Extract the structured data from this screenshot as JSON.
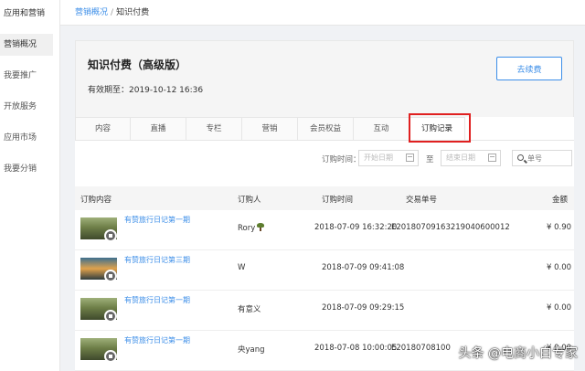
{
  "sidebar": {
    "title": "应用和营销",
    "items": [
      {
        "label": "营销概况"
      },
      {
        "label": "我要推广"
      },
      {
        "label": "开放服务"
      },
      {
        "label": "应用市场"
      },
      {
        "label": "我要分销"
      }
    ]
  },
  "breadcrumb": {
    "parent": "营销概况",
    "separator": "/",
    "current": "知识付费"
  },
  "header": {
    "title": "知识付费（高级版）",
    "expiry": "有效期至：2019-10-12 16:36",
    "renew_label": "去续费"
  },
  "tabs": [
    {
      "label": "内容"
    },
    {
      "label": "直播"
    },
    {
      "label": "专栏"
    },
    {
      "label": "营销"
    },
    {
      "label": "会员权益"
    },
    {
      "label": "互动"
    },
    {
      "label": "订购记录"
    }
  ],
  "filter": {
    "label": "订购时间：",
    "start_placeholder": "开始日期",
    "to": "至",
    "end_placeholder": "结束日期",
    "search_placeholder": "单号"
  },
  "table": {
    "headers": {
      "content": "订购内容",
      "buyer": "订购人",
      "time": "订购时间",
      "order_no": "交易单号",
      "amount": "金额"
    },
    "rows": [
      {
        "title": "有赞旅行日记第一期",
        "buyer": "Rory",
        "time": "2018-07-09 16:32:20",
        "order_no": "E20180709163219040600012",
        "amount": "¥ 0.90"
      },
      {
        "title": "有赞旅行日记第三期",
        "buyer": "W",
        "time": "2018-07-09 09:41:08",
        "order_no": "",
        "amount": "¥ 0.00"
      },
      {
        "title": "有赞旅行日记第一期",
        "buyer": "有意义",
        "time": "2018-07-09 09:29:15",
        "order_no": "",
        "amount": "¥ 0.00"
      },
      {
        "title": "有赞旅行日记第一期",
        "buyer": "央yang",
        "time": "2018-07-08 10:00:05",
        "order_no": "E20180708100",
        "amount": "¥ 0.00"
      }
    ]
  },
  "watermark": "头条 @电商小白专家",
  "colors": {
    "accent": "#3c8ee8",
    "highlight": "#e02020"
  }
}
